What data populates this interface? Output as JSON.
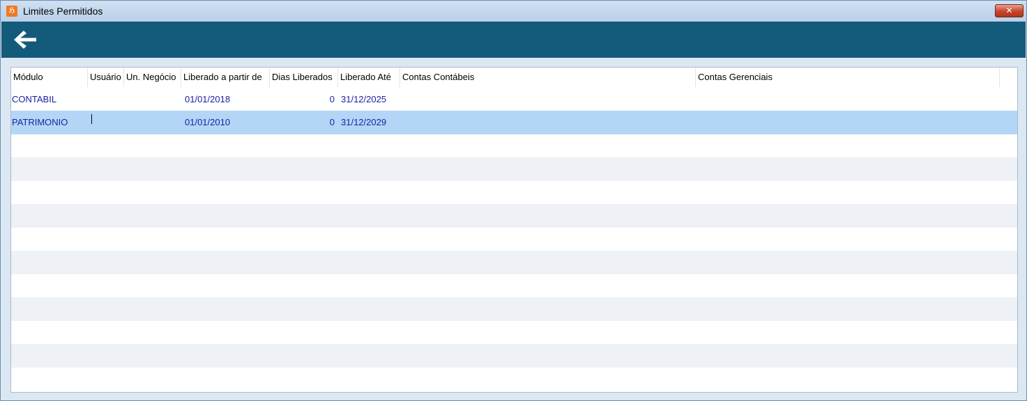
{
  "window": {
    "title": "Limites Permitidos",
    "close_label": "✕",
    "app_icon": "sales-app-icon"
  },
  "toolbar": {
    "back_icon": "arrow-left-icon"
  },
  "grid": {
    "columns": [
      "Módulo",
      "Usuário",
      "Un. Negócio",
      "Liberado a partir de",
      "Dias Liberados",
      "Liberado Até",
      "Contas Contábeis",
      "Contas Gerenciais"
    ],
    "rows": [
      {
        "modulo": "CONTABIL",
        "usuario": "",
        "un_negocio": "",
        "liberado_de": "01/01/2018",
        "dias": "0",
        "liberado_ate": "31/12/2025",
        "contas_contabeis": "",
        "contas_gerenciais": ""
      },
      {
        "modulo": "PATRIMONIO",
        "usuario": "",
        "un_negocio": "",
        "liberado_de": "01/01/2010",
        "dias": "0",
        "liberado_ate": "31/12/2029",
        "contas_contabeis": "",
        "contas_gerenciais": ""
      }
    ],
    "selected_row": 1
  },
  "colors": {
    "toolbar": "#145a7a",
    "selected_row": "#b3d6f7",
    "cell_text": "#1b1fa0",
    "alt_row": "#eef1f5"
  }
}
